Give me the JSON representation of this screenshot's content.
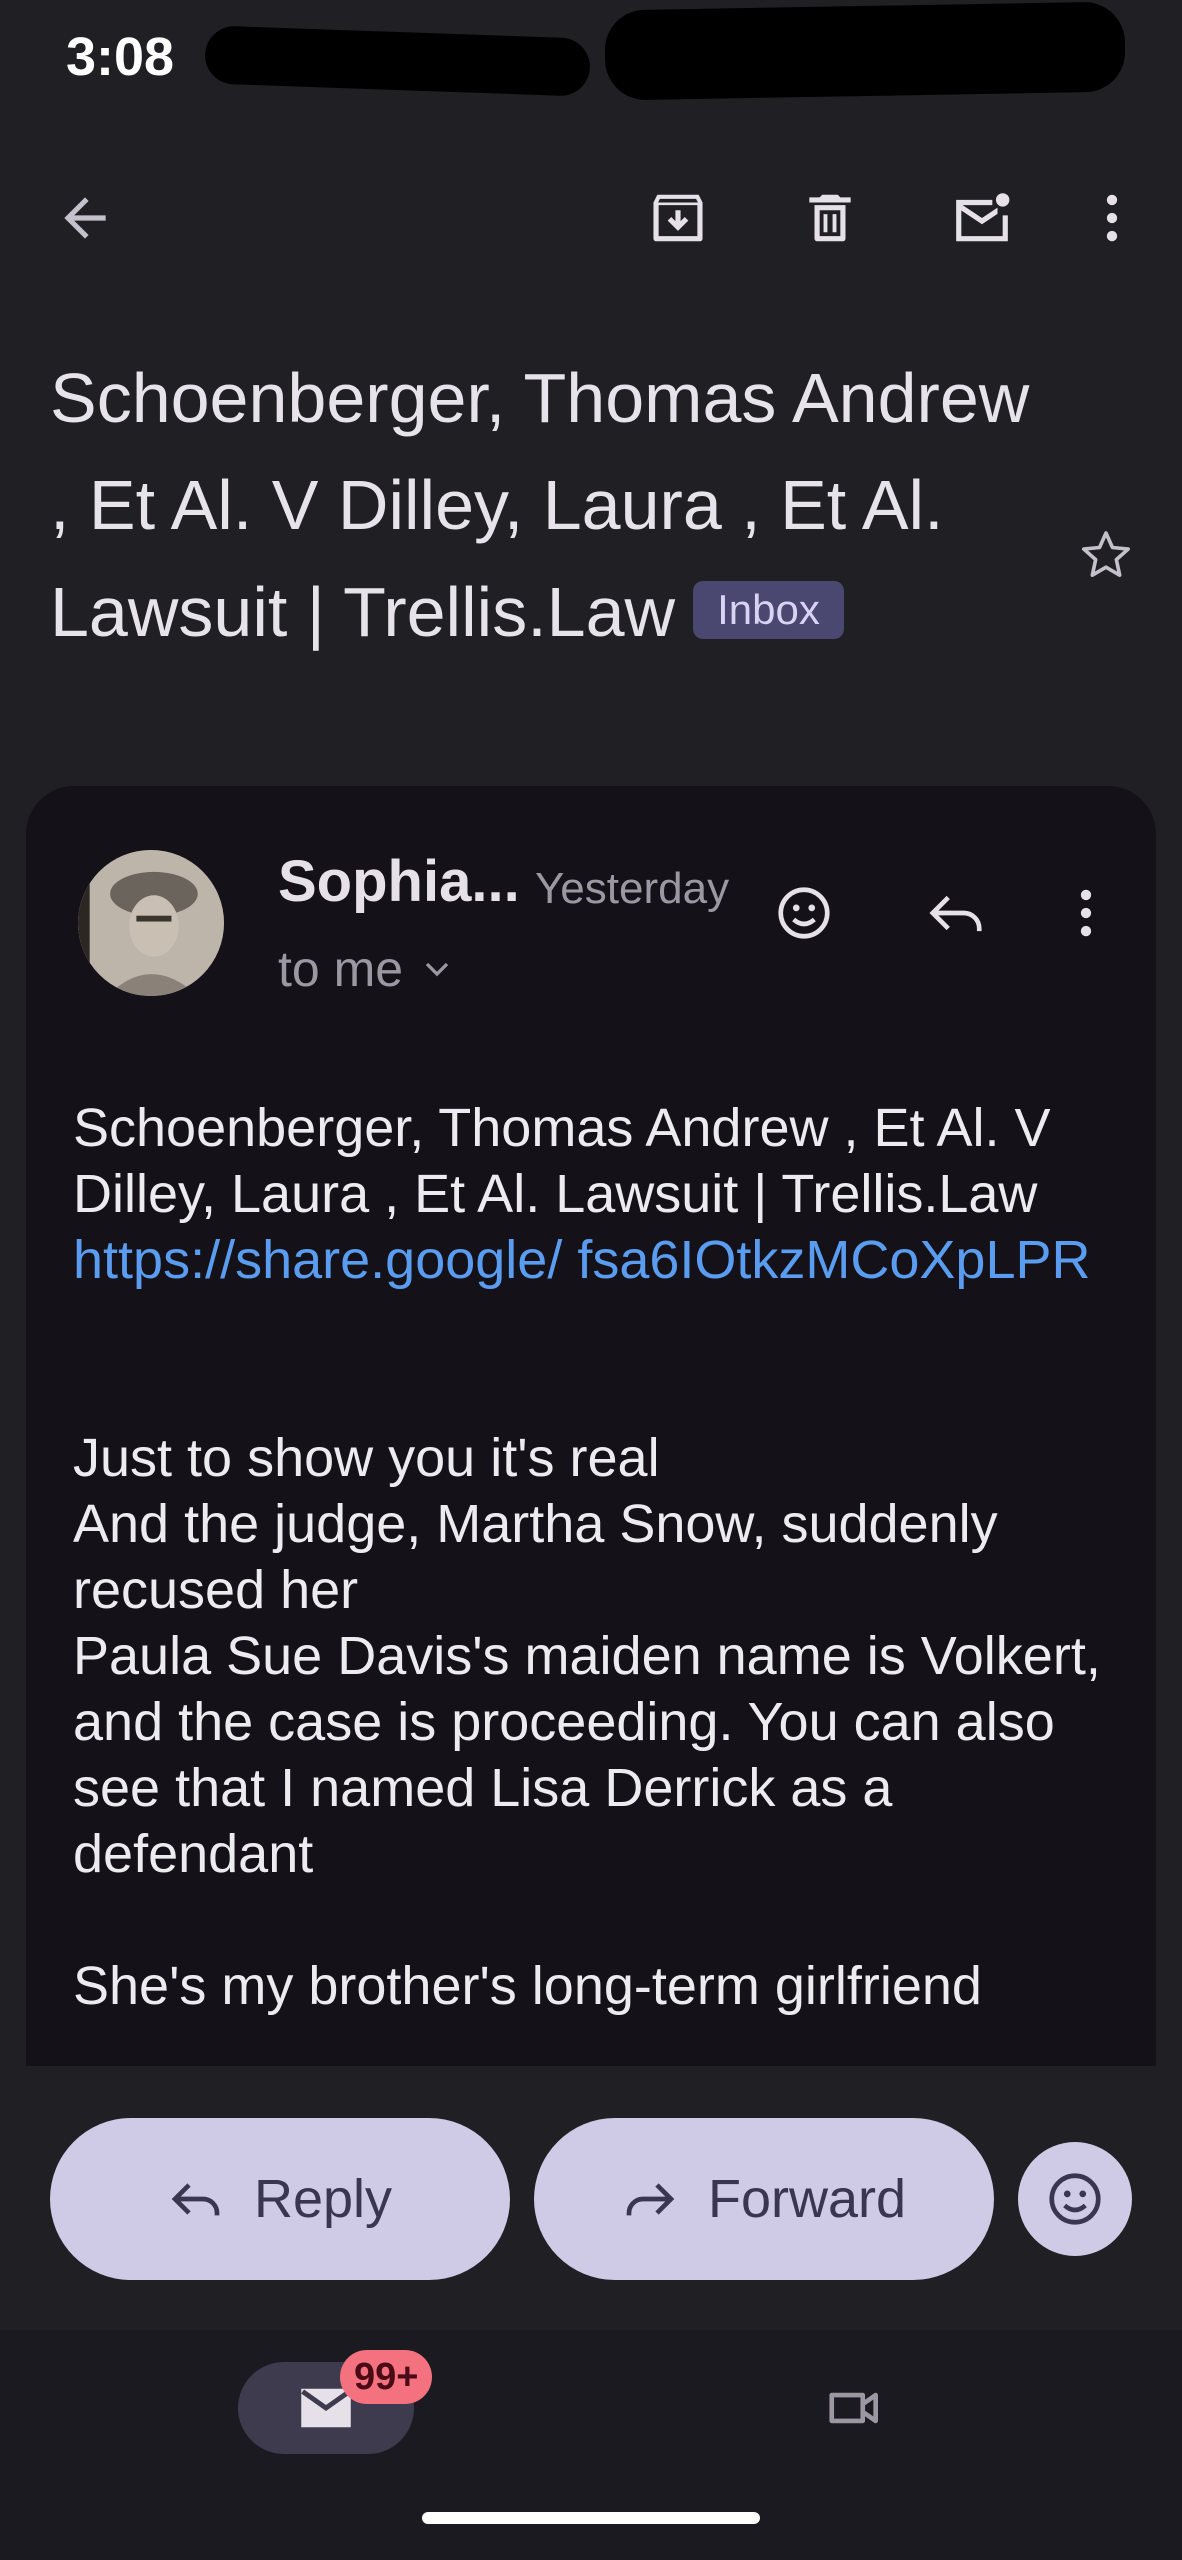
{
  "status_bar": {
    "time": "3:08"
  },
  "email": {
    "subject": "Schoenberger, Thomas Andrew , Et Al. V Dilley, Laura , Et Al. Lawsuit | Trellis.Law",
    "label_badge": "Inbox",
    "sender": "Sophia...",
    "date": "Yesterday",
    "recipient": "to me",
    "body": {
      "line1": "Schoenberger, Thomas Andrew , Et Al. V Dilley, Laura , Et Al. Lawsuit | Trellis.Law",
      "link": "https://share.google/ fsa6IOtkzMCoXpLPR",
      "para2": "Just to show you it's real",
      "para3": "And the judge, Martha Snow, suddenly recused her",
      "para4": "Paula Sue Davis's maiden name is Volkert, and the case is proceeding. You can also see that I named Lisa Derrick as a defendant",
      "para5": "She's my brother's long-term girlfriend"
    }
  },
  "actions": {
    "reply_label": "Reply",
    "forward_label": "Forward"
  },
  "bottom_nav": {
    "mail_count": "99+"
  },
  "icons": {
    "back": "arrow-back-icon",
    "archive": "archive-icon",
    "delete": "trash-icon",
    "mark_unread": "mark-unread-icon",
    "more": "more-vert-icon",
    "star": "star-icon",
    "emoji": "emoji-icon",
    "reply": "reply-icon",
    "forward": "forward-icon",
    "mail": "mail-icon",
    "meet": "video-icon"
  }
}
